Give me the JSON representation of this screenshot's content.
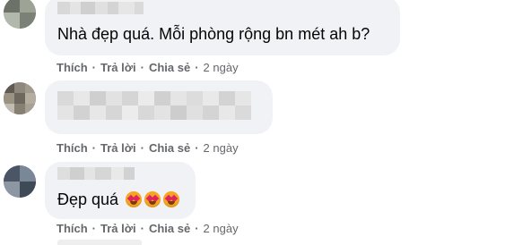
{
  "comments": [
    {
      "text": "Nhà đẹp quá. Mỗi phòng rộng bn mét ah b?",
      "actions": {
        "like": "Thích",
        "reply": "Trả lời",
        "share": "Chia sẻ",
        "time": "2 ngày"
      }
    },
    {
      "text": "",
      "actions": {
        "like": "Thích",
        "reply": "Trả lời",
        "share": "Chia sẻ",
        "time": "2 ngày"
      }
    },
    {
      "text": "Đẹp quá",
      "emojis": [
        "heart-eyes-emoji",
        "heart-eyes-emoji",
        "heart-eyes-emoji"
      ],
      "actions": {
        "like": "Thích",
        "reply": "Trả lời",
        "share": "Chia sẻ",
        "time": "2 ngày"
      }
    }
  ],
  "separator": "·",
  "colors": {
    "bubble": "#f0f2f5",
    "text": "#050505",
    "meta": "#65676b",
    "emoji_face": "#f5a623",
    "emoji_heart": "#e0245e"
  }
}
